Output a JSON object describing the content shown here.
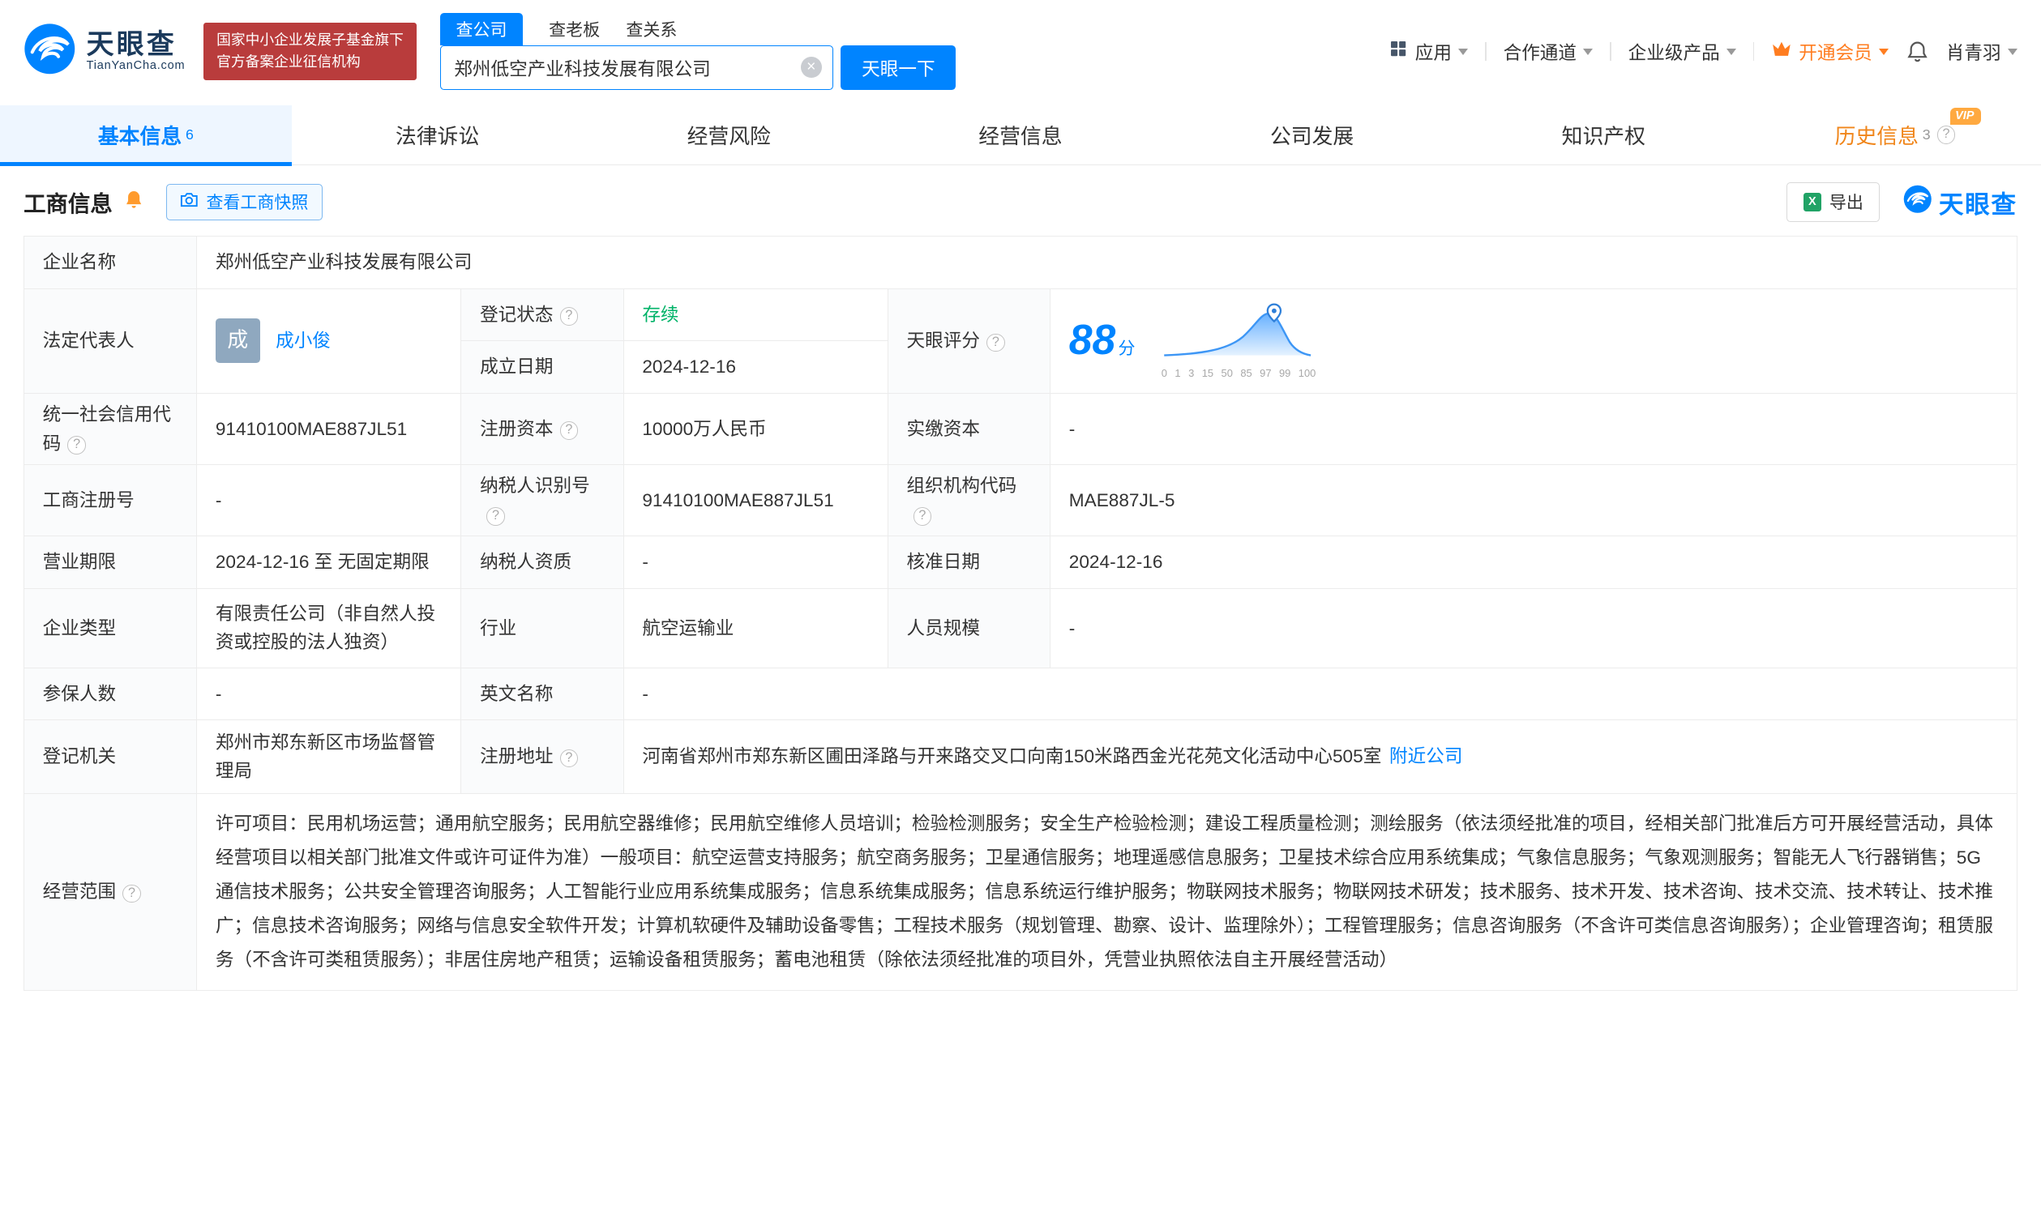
{
  "header": {
    "brand": "天眼查",
    "brand_domain": "TianYanCha.com",
    "badge_line1": "国家中小企业发展子基金旗下",
    "badge_line2": "官方备案企业征信机构",
    "search_tabs": {
      "company": "查公司",
      "boss": "查老板",
      "relation": "查关系"
    },
    "search_value": "郑州低空产业科技发展有限公司",
    "search_button": "天眼一下",
    "nav_apps": "应用",
    "nav_cooperation": "合作通道",
    "nav_enterprise": "企业级产品",
    "nav_vip": "开通会员",
    "username": "肖青羽"
  },
  "tabs": {
    "basic": "基本信息",
    "basic_count": "6",
    "legal": "法律诉讼",
    "risk": "经营风险",
    "operation": "经营信息",
    "development": "公司发展",
    "ip": "知识产权",
    "history": "历史信息",
    "history_count": "3",
    "history_vip": "VIP"
  },
  "section": {
    "title": "工商信息",
    "snapshot": "查看工商快照",
    "export": "导出",
    "watermark": "天眼查"
  },
  "icons": {
    "clear": "×",
    "help": "?",
    "caret": "▾"
  },
  "info": {
    "company_name_label": "企业名称",
    "company_name": "郑州低空产业科技发展有限公司",
    "legal_rep_label": "法定代表人",
    "legal_rep_avatar": "成",
    "legal_rep_name": "成小俊",
    "reg_status_label": "登记状态",
    "reg_status": "存续",
    "score_label": "天眼评分",
    "score_value": "88",
    "score_unit": "分",
    "score_axis": [
      "0",
      "1",
      "3",
      "15",
      "50",
      "85",
      "97",
      "99",
      "100"
    ],
    "establish_label": "成立日期",
    "establish_date": "2024-12-16",
    "credit_code_label": "统一社会信用代码",
    "credit_code": "91410100MAE887JL51",
    "reg_capital_label": "注册资本",
    "reg_capital": "10000万人民币",
    "paid_capital_label": "实缴资本",
    "paid_capital": "-",
    "reg_number_label": "工商注册号",
    "reg_number": "-",
    "taxpayer_id_label": "纳税人识别号",
    "taxpayer_id": "91410100MAE887JL51",
    "org_code_label": "组织机构代码",
    "org_code": "MAE887JL-5",
    "business_term_label": "营业期限",
    "business_term": "2024-12-16 至 无固定期限",
    "taxpayer_quality_label": "纳税人资质",
    "taxpayer_quality": "-",
    "approval_date_label": "核准日期",
    "approval_date": "2024-12-16",
    "company_type_label": "企业类型",
    "company_type": "有限责任公司（非自然人投资或控股的法人独资）",
    "industry_label": "行业",
    "industry": "航空运输业",
    "staff_size_label": "人员规模",
    "staff_size": "-",
    "insured_label": "参保人数",
    "insured": "-",
    "english_name_label": "英文名称",
    "english_name": "-",
    "reg_authority_label": "登记机关",
    "reg_authority": "郑州市郑东新区市场监督管理局",
    "address_label": "注册地址",
    "address": "河南省郑州市郑东新区圃田泽路与开来路交叉口向南150米路西金光花苑文化活动中心505室",
    "nearby_link": "附近公司",
    "scope_label": "经营范围",
    "scope": "许可项目：民用机场运营；通用航空服务；民用航空器维修；民用航空维修人员培训；检验检测服务；安全生产检验检测；建设工程质量检测；测绘服务（依法须经批准的项目，经相关部门批准后方可开展经营活动，具体经营项目以相关部门批准文件或许可证件为准）一般项目：航空运营支持服务；航空商务服务；卫星通信服务；地理遥感信息服务；卫星技术综合应用系统集成；气象信息服务；气象观测服务；智能无人飞行器销售；5G通信技术服务；公共安全管理咨询服务；人工智能行业应用系统集成服务；信息系统集成服务；信息系统运行维护服务；物联网技术服务；物联网技术研发；技术服务、技术开发、技术咨询、技术交流、技术转让、技术推广；信息技术咨询服务；网络与信息安全软件开发；计算机软硬件及辅助设备零售；工程技术服务（规划管理、勘察、设计、监理除外）；工程管理服务；信息咨询服务（不含许可类信息咨询服务）；企业管理咨询；租赁服务（不含许可类租赁服务）；非居住房地产租赁；运输设备租赁服务；蓄电池租赁（除依法须经批准的项目外，凭营业执照依法自主开展经营活动）"
  }
}
